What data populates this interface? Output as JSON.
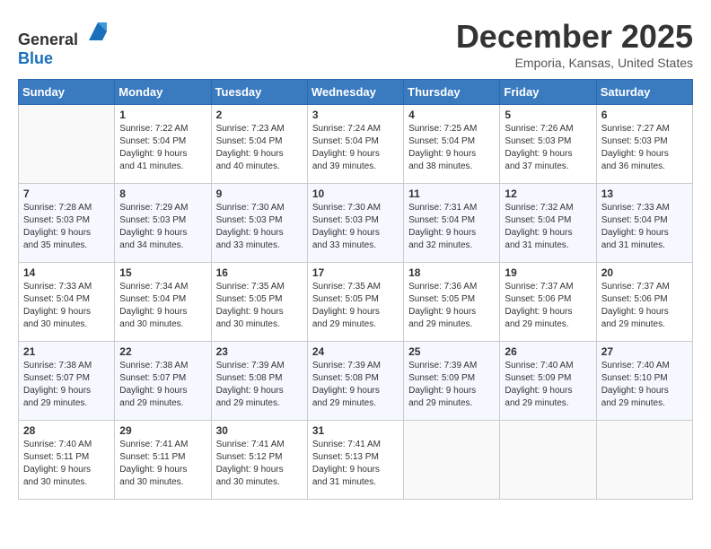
{
  "logo": {
    "general": "General",
    "blue": "Blue"
  },
  "header": {
    "title": "December 2025",
    "subtitle": "Emporia, Kansas, United States"
  },
  "weekdays": [
    "Sunday",
    "Monday",
    "Tuesday",
    "Wednesday",
    "Thursday",
    "Friday",
    "Saturday"
  ],
  "weeks": [
    [
      {
        "day": "",
        "content": ""
      },
      {
        "day": "1",
        "content": "Sunrise: 7:22 AM\nSunset: 5:04 PM\nDaylight: 9 hours\nand 41 minutes."
      },
      {
        "day": "2",
        "content": "Sunrise: 7:23 AM\nSunset: 5:04 PM\nDaylight: 9 hours\nand 40 minutes."
      },
      {
        "day": "3",
        "content": "Sunrise: 7:24 AM\nSunset: 5:04 PM\nDaylight: 9 hours\nand 39 minutes."
      },
      {
        "day": "4",
        "content": "Sunrise: 7:25 AM\nSunset: 5:04 PM\nDaylight: 9 hours\nand 38 minutes."
      },
      {
        "day": "5",
        "content": "Sunrise: 7:26 AM\nSunset: 5:03 PM\nDaylight: 9 hours\nand 37 minutes."
      },
      {
        "day": "6",
        "content": "Sunrise: 7:27 AM\nSunset: 5:03 PM\nDaylight: 9 hours\nand 36 minutes."
      }
    ],
    [
      {
        "day": "7",
        "content": "Sunrise: 7:28 AM\nSunset: 5:03 PM\nDaylight: 9 hours\nand 35 minutes."
      },
      {
        "day": "8",
        "content": "Sunrise: 7:29 AM\nSunset: 5:03 PM\nDaylight: 9 hours\nand 34 minutes."
      },
      {
        "day": "9",
        "content": "Sunrise: 7:30 AM\nSunset: 5:03 PM\nDaylight: 9 hours\nand 33 minutes."
      },
      {
        "day": "10",
        "content": "Sunrise: 7:30 AM\nSunset: 5:03 PM\nDaylight: 9 hours\nand 33 minutes."
      },
      {
        "day": "11",
        "content": "Sunrise: 7:31 AM\nSunset: 5:04 PM\nDaylight: 9 hours\nand 32 minutes."
      },
      {
        "day": "12",
        "content": "Sunrise: 7:32 AM\nSunset: 5:04 PM\nDaylight: 9 hours\nand 31 minutes."
      },
      {
        "day": "13",
        "content": "Sunrise: 7:33 AM\nSunset: 5:04 PM\nDaylight: 9 hours\nand 31 minutes."
      }
    ],
    [
      {
        "day": "14",
        "content": "Sunrise: 7:33 AM\nSunset: 5:04 PM\nDaylight: 9 hours\nand 30 minutes."
      },
      {
        "day": "15",
        "content": "Sunrise: 7:34 AM\nSunset: 5:04 PM\nDaylight: 9 hours\nand 30 minutes."
      },
      {
        "day": "16",
        "content": "Sunrise: 7:35 AM\nSunset: 5:05 PM\nDaylight: 9 hours\nand 30 minutes."
      },
      {
        "day": "17",
        "content": "Sunrise: 7:35 AM\nSunset: 5:05 PM\nDaylight: 9 hours\nand 29 minutes."
      },
      {
        "day": "18",
        "content": "Sunrise: 7:36 AM\nSunset: 5:05 PM\nDaylight: 9 hours\nand 29 minutes."
      },
      {
        "day": "19",
        "content": "Sunrise: 7:37 AM\nSunset: 5:06 PM\nDaylight: 9 hours\nand 29 minutes."
      },
      {
        "day": "20",
        "content": "Sunrise: 7:37 AM\nSunset: 5:06 PM\nDaylight: 9 hours\nand 29 minutes."
      }
    ],
    [
      {
        "day": "21",
        "content": "Sunrise: 7:38 AM\nSunset: 5:07 PM\nDaylight: 9 hours\nand 29 minutes."
      },
      {
        "day": "22",
        "content": "Sunrise: 7:38 AM\nSunset: 5:07 PM\nDaylight: 9 hours\nand 29 minutes."
      },
      {
        "day": "23",
        "content": "Sunrise: 7:39 AM\nSunset: 5:08 PM\nDaylight: 9 hours\nand 29 minutes."
      },
      {
        "day": "24",
        "content": "Sunrise: 7:39 AM\nSunset: 5:08 PM\nDaylight: 9 hours\nand 29 minutes."
      },
      {
        "day": "25",
        "content": "Sunrise: 7:39 AM\nSunset: 5:09 PM\nDaylight: 9 hours\nand 29 minutes."
      },
      {
        "day": "26",
        "content": "Sunrise: 7:40 AM\nSunset: 5:09 PM\nDaylight: 9 hours\nand 29 minutes."
      },
      {
        "day": "27",
        "content": "Sunrise: 7:40 AM\nSunset: 5:10 PM\nDaylight: 9 hours\nand 29 minutes."
      }
    ],
    [
      {
        "day": "28",
        "content": "Sunrise: 7:40 AM\nSunset: 5:11 PM\nDaylight: 9 hours\nand 30 minutes."
      },
      {
        "day": "29",
        "content": "Sunrise: 7:41 AM\nSunset: 5:11 PM\nDaylight: 9 hours\nand 30 minutes."
      },
      {
        "day": "30",
        "content": "Sunrise: 7:41 AM\nSunset: 5:12 PM\nDaylight: 9 hours\nand 30 minutes."
      },
      {
        "day": "31",
        "content": "Sunrise: 7:41 AM\nSunset: 5:13 PM\nDaylight: 9 hours\nand 31 minutes."
      },
      {
        "day": "",
        "content": ""
      },
      {
        "day": "",
        "content": ""
      },
      {
        "day": "",
        "content": ""
      }
    ]
  ]
}
